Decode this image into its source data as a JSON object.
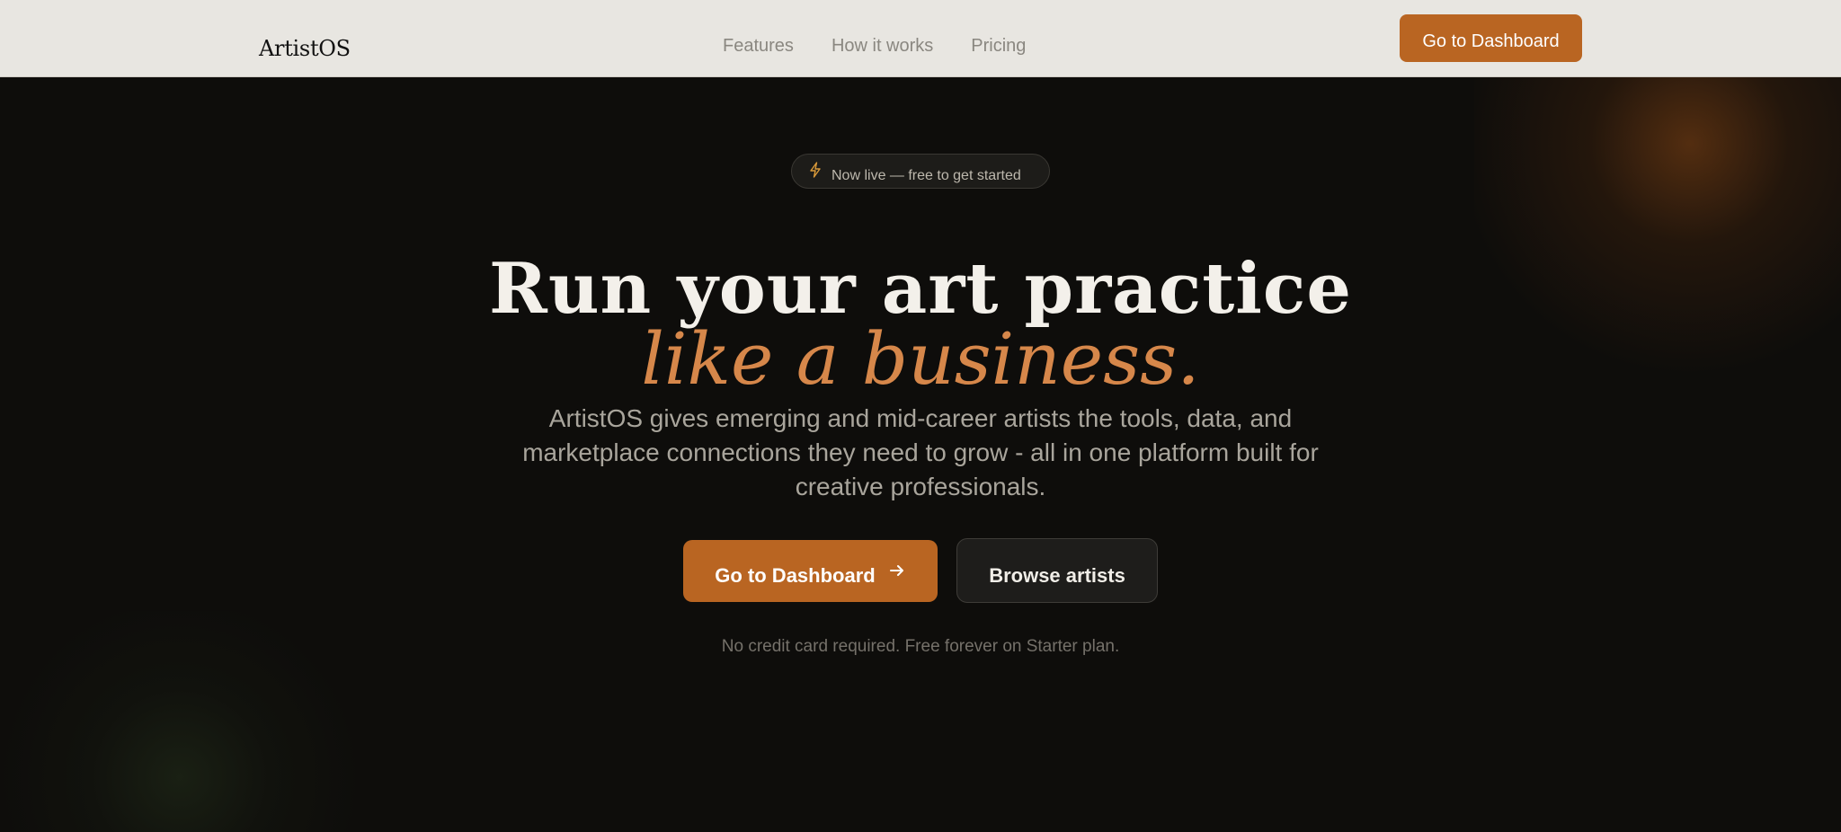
{
  "nav": {
    "logo": "ArtistOS",
    "links": [
      "Features",
      "How it works",
      "Pricing"
    ],
    "cta_label": "Go to Dashboard"
  },
  "hero": {
    "badge_icon": "lightning-icon",
    "badge_text": "Now live — free to get started",
    "headline": "Run your art practice",
    "headline_accent": "like a business.",
    "subtitle": "ArtistOS gives emerging and mid-career artists the tools, data, and marketplace connections they need to grow - all in one platform built for creative professionals.",
    "primary_cta": "Go to Dashboard",
    "primary_cta_icon": "arrow-right-icon",
    "secondary_cta": "Browse artists",
    "fine_print": "No credit card required. Free forever on Starter plan."
  },
  "colors": {
    "accent": "#b96522",
    "accent_text": "#d6874a",
    "background": "#0e0d0b",
    "navbar": "#e8e6e1"
  }
}
